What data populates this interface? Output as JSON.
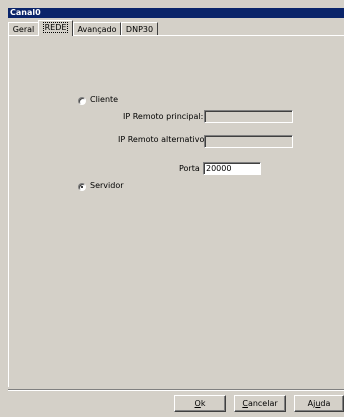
{
  "window": {
    "title": "Canal0"
  },
  "tabs": [
    {
      "label": "Geral",
      "active": false
    },
    {
      "label": "REDE",
      "active": true
    },
    {
      "label": "Avançado",
      "active": false
    },
    {
      "label": "DNP30",
      "active": false
    }
  ],
  "network": {
    "client_label": "Cliente",
    "server_label": "Servidor",
    "selected_mode": "Servidor",
    "ip_primary_label": "IP Remoto principal:",
    "ip_primary_value": "",
    "ip_secondary_label": "IP Remoto alternativo",
    "ip_secondary_value": "",
    "port_label": "Porta",
    "port_value": "20000"
  },
  "buttons": {
    "ok": {
      "mnemonic": "O",
      "rest": "k"
    },
    "cancel": {
      "mnemonic": "C",
      "rest": "ancelar"
    },
    "help": {
      "prefix": "Aj",
      "mnemonic": "u",
      "rest": "da"
    }
  }
}
